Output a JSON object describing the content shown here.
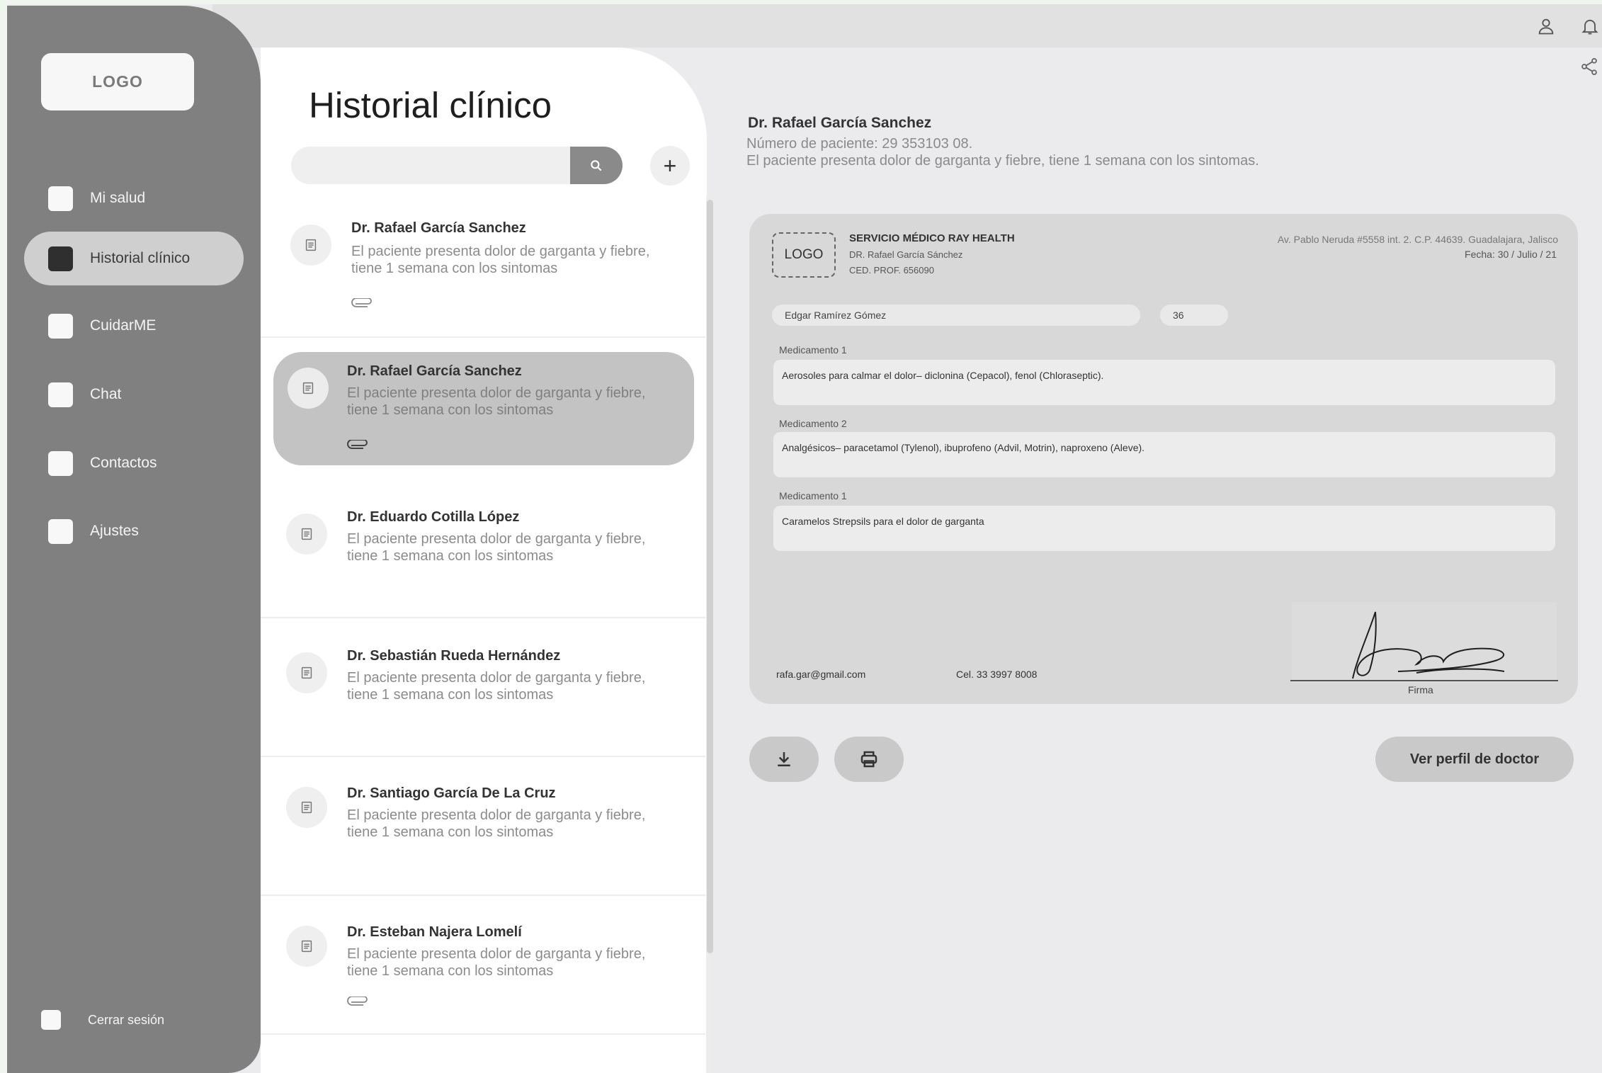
{
  "sidebar": {
    "logo": "LOGO",
    "items": [
      {
        "label": "Mi salud"
      },
      {
        "label": "Historial clínico"
      },
      {
        "label": "CuidarME"
      },
      {
        "label": "Chat"
      },
      {
        "label": "Contactos"
      },
      {
        "label": "Ajustes"
      }
    ],
    "active_item": "Historial clínico",
    "logout": "Cerrar sesión"
  },
  "header": {
    "icons": [
      "user-icon",
      "bell-icon",
      "share-icon"
    ]
  },
  "list": {
    "title": "Historial clínico",
    "search": {
      "placeholder": "",
      "value": ""
    },
    "add_label": "+",
    "cards": [
      {
        "name": "Dr. Rafael García Sanchez",
        "desc": "El paciente presenta dolor de garganta y fiebre, tiene 1 semana con los sintomas",
        "attachment": true
      },
      {
        "name": "Dr. Rafael García Sanchez",
        "desc": "El paciente presenta dolor de garganta y fiebre, tiene 1 semana con los sintomas",
        "attachment": true,
        "selected": true
      },
      {
        "name": "Dr. Eduardo Cotilla López",
        "desc": "El paciente presenta dolor de garganta y fiebre, tiene 1 semana con los sintomas",
        "attachment": false
      },
      {
        "name": "Dr. Sebastián Rueda Hernández",
        "desc": "El paciente presenta dolor de garganta y fiebre, tiene 1 semana con los sintomas",
        "attachment": false
      },
      {
        "name": "Dr. Santiago García De La Cruz",
        "desc": "El paciente presenta dolor de garganta y fiebre, tiene 1 semana con los sintomas",
        "attachment": false
      },
      {
        "name": "Dr. Esteban Najera Lomelí",
        "desc": "El paciente presenta dolor de garganta y fiebre, tiene 1 semana con los sintomas",
        "attachment": true
      }
    ]
  },
  "detail": {
    "doctor": "Dr. Rafael García Sanchez",
    "patient_number": "Número de paciente: 29 353103 08.",
    "summary": "El paciente presenta dolor de garganta y fiebre, tiene 1 semana con los sintomas.",
    "prescription": {
      "logo": "LOGO",
      "service": "SERVICIO MÉDICO RAY HEALTH",
      "doctor": "DR. Rafael García Sánchez",
      "license": "CED. PROF. 656090",
      "address": "Av. Pablo Neruda #5558 int. 2. C.P. 44639. Guadalajara, Jalisco",
      "date": "Fecha: 30 / Julio / 21",
      "patient_name": "Edgar Ramírez Gómez",
      "patient_age": "36",
      "medications": [
        {
          "label": "Medicamento 1",
          "text": "Aerosoles para calmar el dolor– diclonina (Cepacol), fenol (Chloraseptic)."
        },
        {
          "label": "Medicamento 2",
          "text": "Analgésicos– paracetamol (Tylenol), ibuprofeno (Advil, Motrin), naproxeno (Aleve)."
        },
        {
          "label": "Medicamento 1",
          "text": "Caramelos Strepsils para el dolor de garganta"
        }
      ],
      "email": "rafa.gar@gmail.com",
      "phone": "Cel. 33 3997 8008",
      "signature_label": "Firma"
    },
    "actions": {
      "download_icon": "download-icon",
      "print_icon": "print-icon",
      "profile_button": "Ver perfil de doctor"
    }
  }
}
